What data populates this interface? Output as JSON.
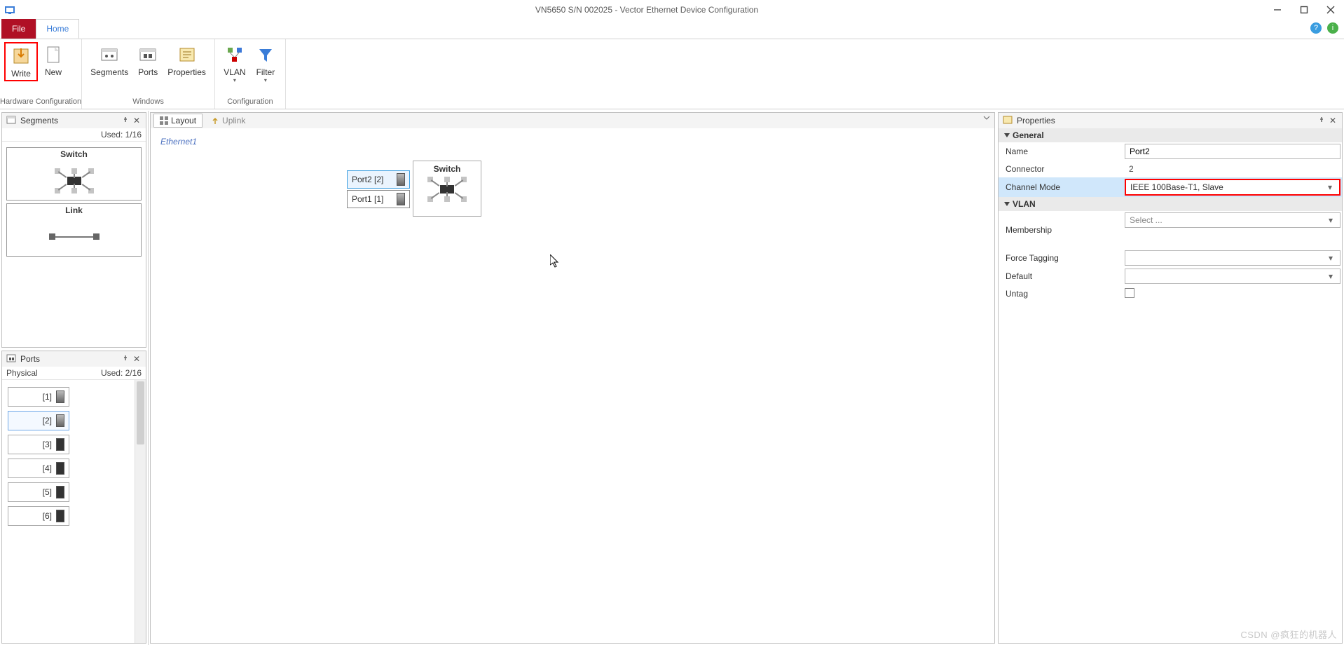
{
  "window": {
    "title": "VN5650 S/N 002025 - Vector Ethernet Device Configuration"
  },
  "tabs": {
    "file": "File",
    "home": "Home"
  },
  "ribbon": {
    "hw_group": "Hardware Configuration",
    "win_group": "Windows",
    "cfg_group": "Configuration",
    "write": "Write",
    "new": "New",
    "segments": "Segments",
    "ports": "Ports",
    "properties": "Properties",
    "vlan": "VLAN",
    "filter": "Filter"
  },
  "segments_panel": {
    "title": "Segments",
    "used": "Used: 1/16",
    "items": [
      {
        "title": "Switch"
      },
      {
        "title": "Link"
      }
    ]
  },
  "ports_panel": {
    "title": "Ports",
    "physical": "Physical",
    "used": "Used: 2/16",
    "rows": [
      {
        "label": "[1]",
        "selected": false
      },
      {
        "label": "[2]",
        "selected": true
      },
      {
        "label": "[3]",
        "selected": false
      },
      {
        "label": "[4]",
        "selected": false
      },
      {
        "label": "[5]",
        "selected": false
      },
      {
        "label": "[6]",
        "selected": false
      }
    ]
  },
  "canvas": {
    "tab_layout": "Layout",
    "tab_uplink": "Uplink",
    "eth_label": "Ethernet1",
    "port2": "Port2  [2]",
    "port1": "Port1  [1]",
    "switch": "Switch"
  },
  "properties": {
    "title": "Properties",
    "general": "General",
    "name_label": "Name",
    "name_value": "Port2",
    "connector_label": "Connector",
    "connector_value": "2",
    "channel_mode_label": "Channel Mode",
    "channel_mode_value": "IEEE 100Base-T1, Slave",
    "vlan": "VLAN",
    "membership_label": "Membership",
    "membership_value": "Select ...",
    "force_tagging_label": "Force Tagging",
    "force_tagging_value": "",
    "default_label": "Default",
    "default_value": "",
    "untag_label": "Untag"
  },
  "watermark": "CSDN @疯狂的机器人"
}
